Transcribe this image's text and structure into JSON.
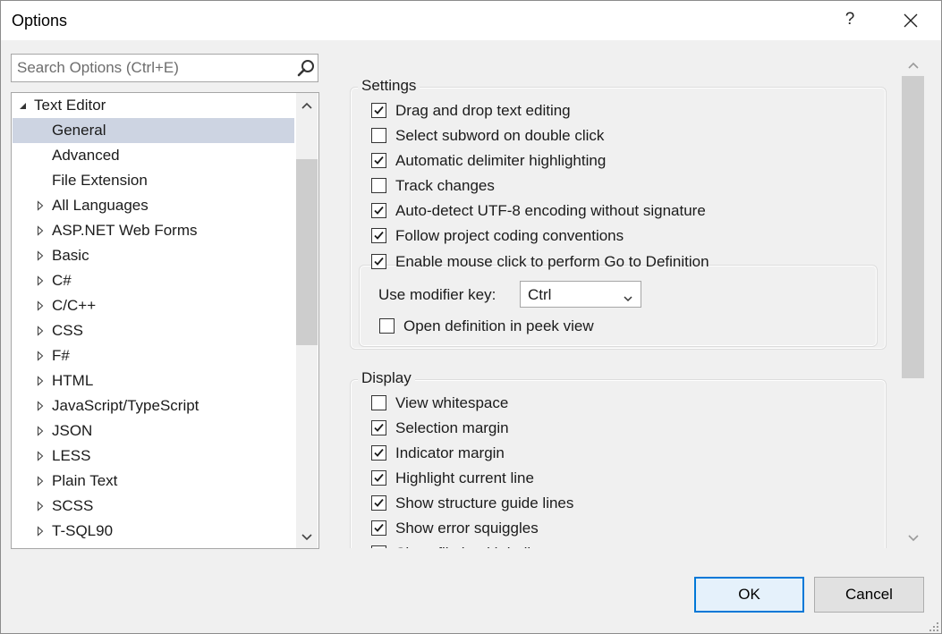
{
  "window": {
    "title": "Options",
    "help": "?"
  },
  "search": {
    "placeholder": "Search Options (Ctrl+E)"
  },
  "tree": {
    "items": [
      {
        "label": "Text Editor",
        "level": 0,
        "state": "expanded",
        "selected": false
      },
      {
        "label": "General",
        "level": 1,
        "state": "leaf",
        "selected": true
      },
      {
        "label": "Advanced",
        "level": 1,
        "state": "leaf",
        "selected": false
      },
      {
        "label": "File Extension",
        "level": 1,
        "state": "leaf",
        "selected": false
      },
      {
        "label": "All Languages",
        "level": 1,
        "state": "collapsed",
        "selected": false
      },
      {
        "label": "ASP.NET Web Forms",
        "level": 1,
        "state": "collapsed",
        "selected": false
      },
      {
        "label": "Basic",
        "level": 1,
        "state": "collapsed",
        "selected": false
      },
      {
        "label": "C#",
        "level": 1,
        "state": "collapsed",
        "selected": false
      },
      {
        "label": "C/C++",
        "level": 1,
        "state": "collapsed",
        "selected": false
      },
      {
        "label": "CSS",
        "level": 1,
        "state": "collapsed",
        "selected": false
      },
      {
        "label": "F#",
        "level": 1,
        "state": "collapsed",
        "selected": false
      },
      {
        "label": "HTML",
        "level": 1,
        "state": "collapsed",
        "selected": false
      },
      {
        "label": "JavaScript/TypeScript",
        "level": 1,
        "state": "collapsed",
        "selected": false
      },
      {
        "label": "JSON",
        "level": 1,
        "state": "collapsed",
        "selected": false
      },
      {
        "label": "LESS",
        "level": 1,
        "state": "collapsed",
        "selected": false
      },
      {
        "label": "Plain Text",
        "level": 1,
        "state": "collapsed",
        "selected": false
      },
      {
        "label": "SCSS",
        "level": 1,
        "state": "collapsed",
        "selected": false
      },
      {
        "label": "T-SQL90",
        "level": 1,
        "state": "collapsed",
        "selected": false
      }
    ]
  },
  "settings": {
    "label": "Settings",
    "options": [
      {
        "label": "Drag and drop text editing",
        "checked": true
      },
      {
        "label": "Select subword on double click",
        "checked": false
      },
      {
        "label": "Automatic delimiter highlighting",
        "checked": true
      },
      {
        "label": "Track changes",
        "checked": false
      },
      {
        "label": "Auto-detect UTF-8 encoding without signature",
        "checked": true
      },
      {
        "label": "Follow project coding conventions",
        "checked": true
      }
    ],
    "goto_definition": {
      "label": "Enable mouse click to perform Go to Definition",
      "checked": true,
      "modifier_label": "Use modifier key:",
      "modifier_value": "Ctrl",
      "peek": {
        "label": "Open definition in peek view",
        "checked": false
      }
    }
  },
  "display": {
    "label": "Display",
    "options": [
      {
        "label": "View whitespace",
        "checked": false
      },
      {
        "label": "Selection margin",
        "checked": true
      },
      {
        "label": "Indicator margin",
        "checked": true
      },
      {
        "label": "Highlight current line",
        "checked": true
      },
      {
        "label": "Show structure guide lines",
        "checked": true
      },
      {
        "label": "Show error squiggles",
        "checked": true
      },
      {
        "label": "Show file health indicator",
        "checked": true
      }
    ]
  },
  "buttons": {
    "ok": "OK",
    "cancel": "Cancel"
  },
  "colors": {
    "selection": "#cdd4e2",
    "accent": "#0078d7",
    "scroll_thumb": "#cdcdcd"
  }
}
